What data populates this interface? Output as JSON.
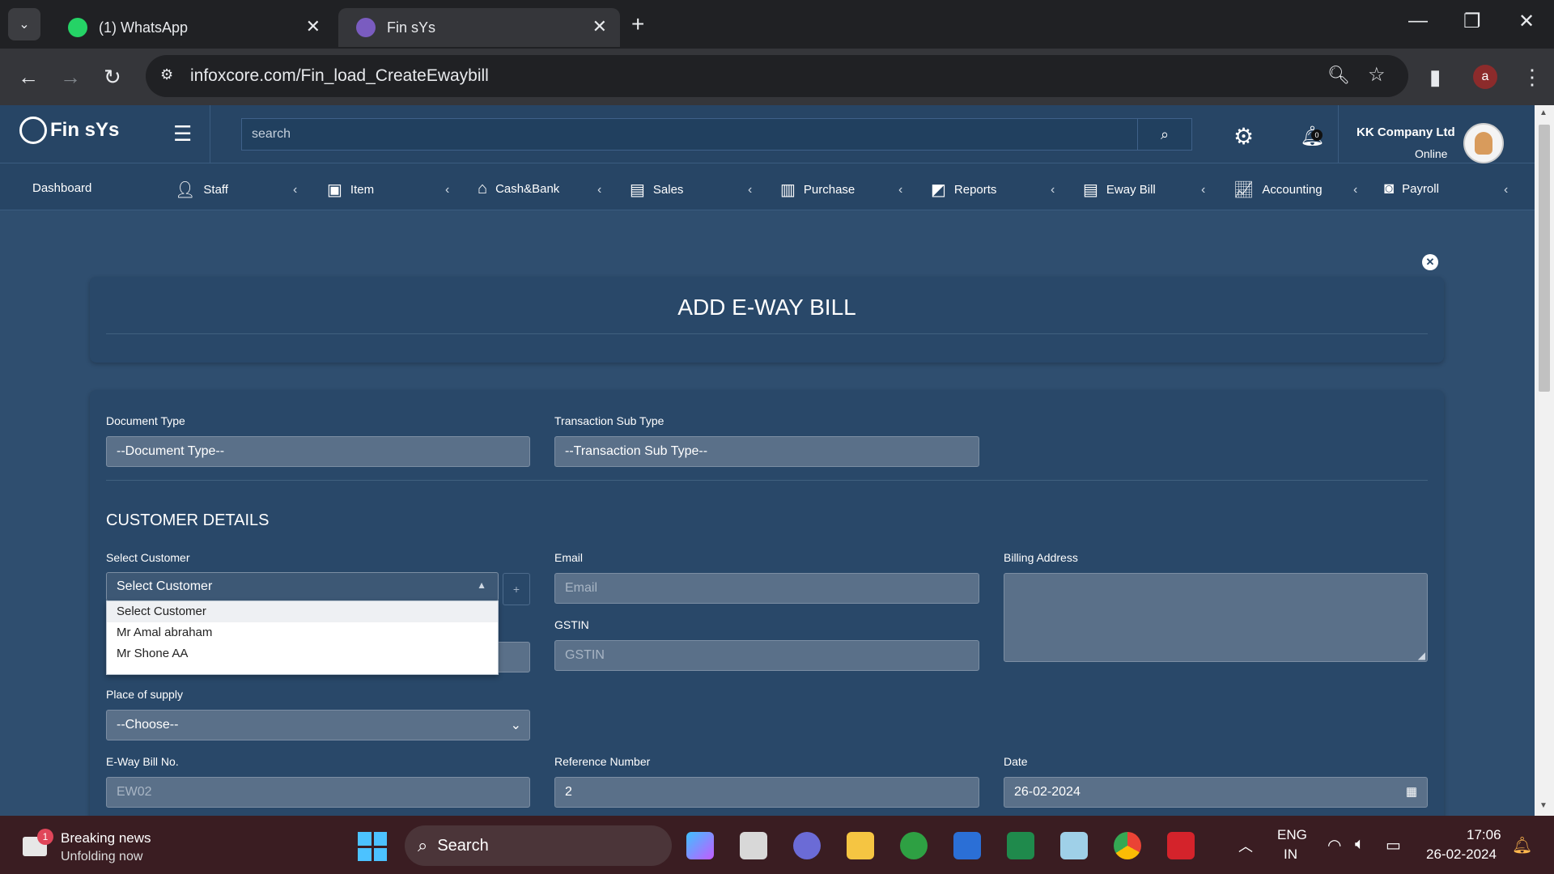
{
  "browser": {
    "tabs": [
      {
        "label": "(1) WhatsApp"
      },
      {
        "label": "Fin sYs"
      }
    ],
    "url": "infoxcore.com/Fin_load_CreateEwaybill",
    "profile_initial": "a"
  },
  "app": {
    "logo": "Fin sYs",
    "search_placeholder": "search",
    "notification_count": "0",
    "company": "KK Company Ltd",
    "status": "Online"
  },
  "menu": [
    {
      "label": "Dashboard"
    },
    {
      "label": "Staff",
      "icon": "user-icon"
    },
    {
      "label": "Item",
      "icon": "box-icon"
    },
    {
      "label": "Cash&Bank",
      "icon": "home-icon"
    },
    {
      "label": "Sales",
      "icon": "document-icon"
    },
    {
      "label": "Purchase",
      "icon": "building-icon"
    },
    {
      "label": "Reports",
      "icon": "chart-icon"
    },
    {
      "label": "Eway Bill",
      "icon": "document-icon"
    },
    {
      "label": "Accounting",
      "icon": "line-chart-icon"
    },
    {
      "label": "Payroll",
      "icon": "money-icon"
    }
  ],
  "form": {
    "title": "ADD E-WAY BILL",
    "document_type_label": "Document Type",
    "document_type_value": "--Document Type--",
    "sub_type_label": "Transaction Sub Type",
    "sub_type_value": "--Transaction Sub Type--",
    "section_customer": "CUSTOMER DETAILS",
    "select_customer_label": "Select Customer",
    "select_customer_value": "Select Customer",
    "customer_options": [
      "Select Customer",
      "Mr Amal abraham",
      "Mr Shone AA"
    ],
    "add_customer_symbol": "+",
    "email_label": "Email",
    "email_placeholder": "Email",
    "gstin_label": "GSTIN",
    "gstin_placeholder": "GSTIN",
    "billing_label": "Billing Address",
    "place_label": "Place of supply",
    "place_value": "--Choose--",
    "eway_no_label": "E-Way Bill No.",
    "eway_no_value": "EW02",
    "ref_label": "Reference Number",
    "ref_value": "2",
    "date_label": "Date",
    "date_value": "26-02-2024"
  },
  "taskbar": {
    "news_title": "Breaking news",
    "news_sub": "Unfolding now",
    "news_badge": "1",
    "search": "Search",
    "lang1": "ENG",
    "lang2": "IN",
    "time": "17:06",
    "date": "26-02-2024"
  },
  "colors": {
    "page_bg": "#2f4e6f",
    "header_bg": "#274565",
    "card_bg": "#294869",
    "taskbar_bg": "#3a1d22"
  }
}
